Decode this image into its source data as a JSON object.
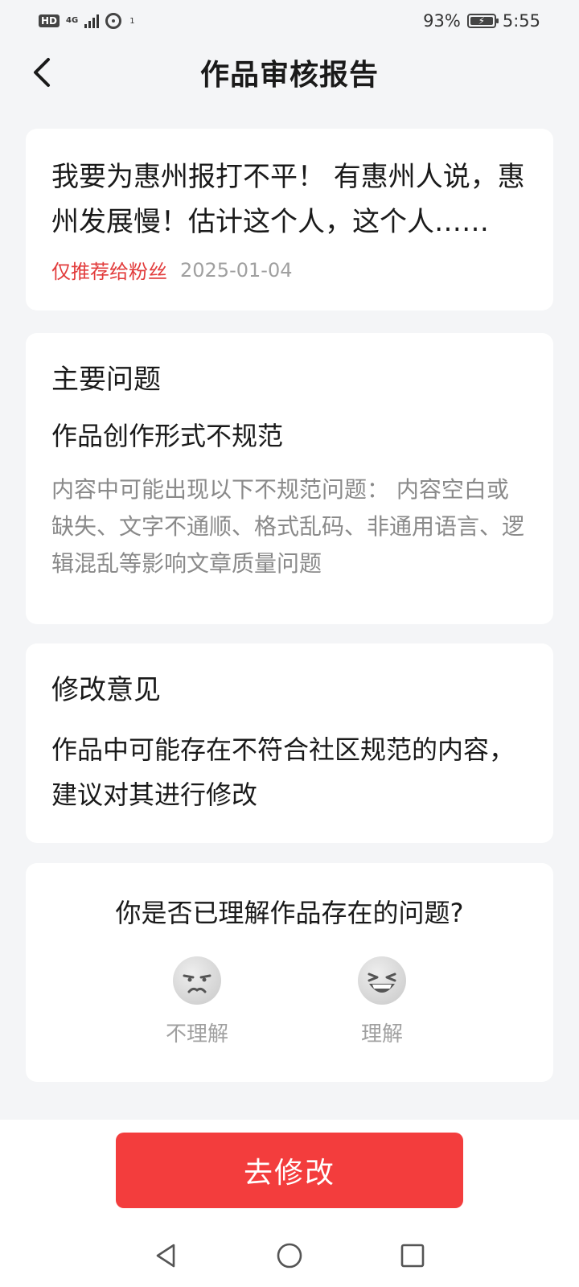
{
  "status_bar": {
    "hd": "HD",
    "network": "4G",
    "hotspot_count": "1",
    "battery": "93%",
    "time": "5:55"
  },
  "header": {
    "title": "作品审核报告",
    "back_icon": "chevron-left-icon"
  },
  "article": {
    "title": "我要为惠州报打不平！ 有惠州人说，惠州发展慢！估计这个人，这个人……",
    "tag": "仅推荐给粉丝",
    "date": "2025-01-04"
  },
  "issue": {
    "heading": "主要问题",
    "name": "作品创作形式不规范",
    "description": "内容中可能出现以下不规范问题： 内容空白或缺失、文字不通顺、格式乱码、非通用语言、逻辑混乱等影响文章质量问题"
  },
  "advice": {
    "heading": "修改意见",
    "text": "作品中可能存在不符合社区规范的内容，建议对其进行修改"
  },
  "feedback": {
    "question": "你是否已理解作品存在的问题?",
    "options": [
      {
        "label": "不理解",
        "icon": "unamused-face-icon"
      },
      {
        "label": "理解",
        "icon": "laughing-face-icon"
      }
    ]
  },
  "actions": {
    "primary_label": "去修改",
    "primary_color": "#f33d3d"
  },
  "colors": {
    "background": "#f4f5f7",
    "card": "#ffffff",
    "tag_red": "#e23c3c",
    "muted_text": "#8a8a8a"
  }
}
